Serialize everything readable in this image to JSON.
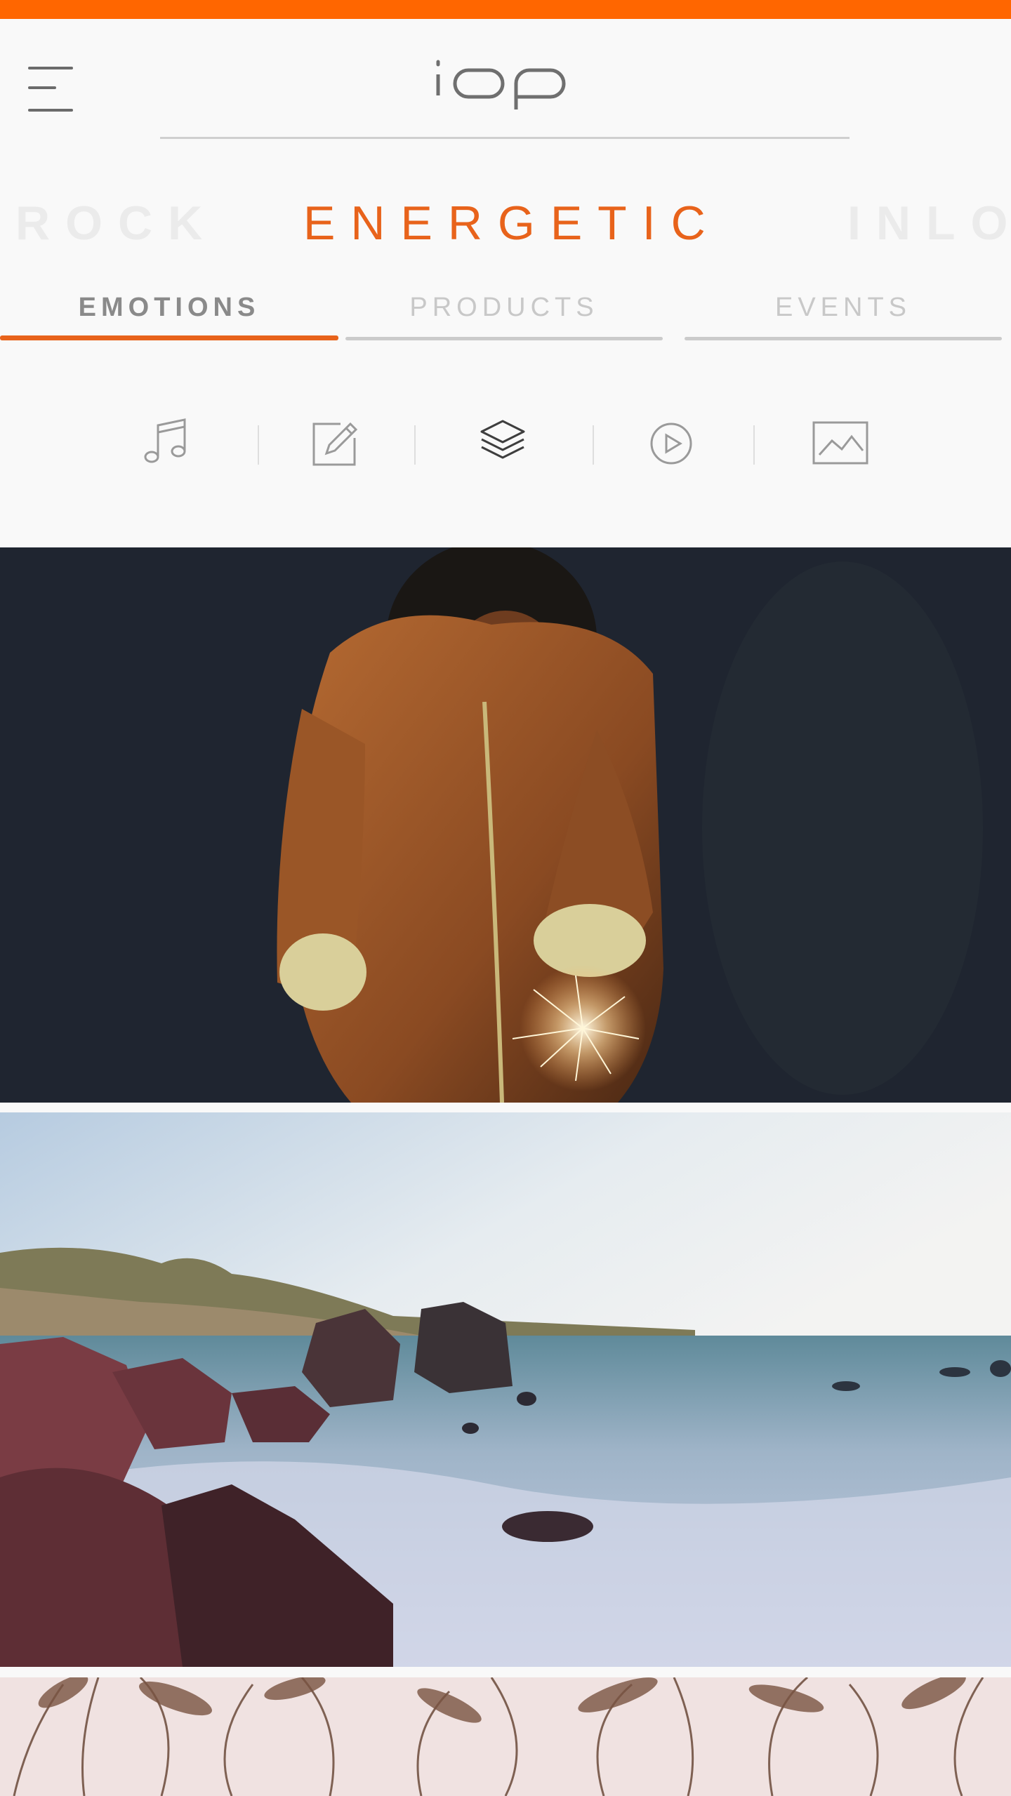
{
  "header": {
    "logo_text": "iop",
    "menu_icon": "hamburger-menu-icon"
  },
  "carousel": {
    "prev": "ROCK",
    "current": "ENERGETIC",
    "next": "INLO"
  },
  "tabs": [
    {
      "label": "EMOTIONS",
      "active": true
    },
    {
      "label": "PRODUCTS",
      "active": false
    },
    {
      "label": "EVENTS",
      "active": false
    }
  ],
  "media_filters": [
    {
      "icon": "music-note-icon"
    },
    {
      "icon": "edit-pencil-icon"
    },
    {
      "icon": "layers-icon",
      "active": true
    },
    {
      "icon": "play-circle-icon"
    },
    {
      "icon": "image-icon"
    }
  ],
  "feed": [
    {
      "image": "child-with-sparkler-photo"
    },
    {
      "image": "rocky-seashore-photo"
    },
    {
      "image": "dry-grass-photo"
    }
  ],
  "colors": {
    "accent": "#ff6600",
    "accent_text": "#e8631b",
    "background": "#f9f9f9"
  }
}
